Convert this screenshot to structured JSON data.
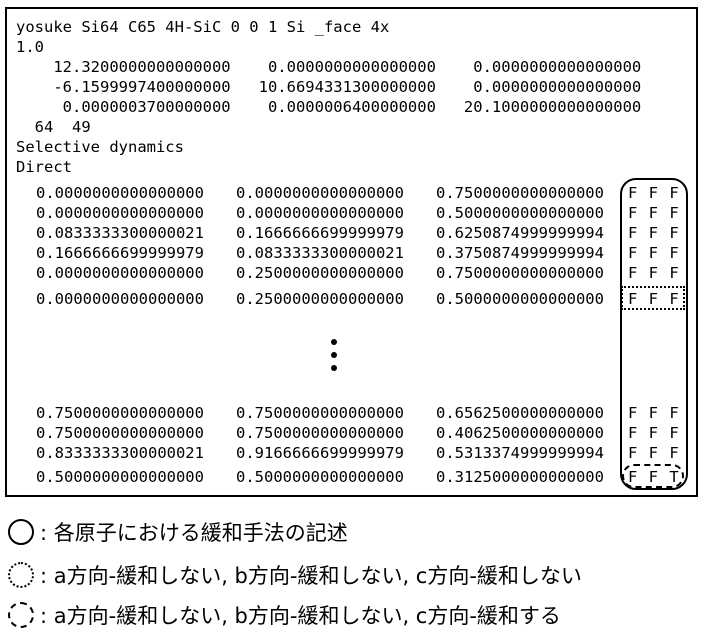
{
  "header": {
    "title_line": "yosuke Si64 C65 4H-SiC 0 0 1 Si _face 4x",
    "scale": "1.0",
    "lattice": [
      "    12.3200000000000000    0.0000000000000000    0.0000000000000000",
      "    -6.1599997400000000   10.6694331300000000    0.0000000000000000",
      "     0.0000003700000000    0.0000006400000000   20.1000000000000000"
    ],
    "counts": "  64  49",
    "selective": "Selective dynamics",
    "coord_type": "Direct"
  },
  "coords_top": [
    {
      "x": "0.0000000000000000",
      "y": "0.0000000000000000",
      "z": "0.7500000000000000",
      "flags": "F F F"
    },
    {
      "x": "0.0000000000000000",
      "y": "0.0000000000000000",
      "z": "0.5000000000000000",
      "flags": "F F F"
    },
    {
      "x": "0.0833333300000021",
      "y": "0.1666666699999979",
      "z": "0.6250874999999994",
      "flags": "F F F"
    },
    {
      "x": "0.1666666699999979",
      "y": "0.0833333300000021",
      "z": "0.3750874999999994",
      "flags": "F F F"
    },
    {
      "x": "0.0000000000000000",
      "y": "0.2500000000000000",
      "z": "0.7500000000000000",
      "flags": "F F F"
    },
    {
      "x": "0.0000000000000000",
      "y": "0.2500000000000000",
      "z": "0.5000000000000000",
      "flags": "F F F"
    }
  ],
  "coords_bottom": [
    {
      "x": "0.7500000000000000",
      "y": "0.7500000000000000",
      "z": "0.6562500000000000",
      "flags": "F F F"
    },
    {
      "x": "0.7500000000000000",
      "y": "0.7500000000000000",
      "z": "0.4062500000000000",
      "flags": "F F F"
    },
    {
      "x": "0.8333333300000021",
      "y": "0.9166666699999979",
      "z": "0.5313374999999994",
      "flags": "F F F"
    },
    {
      "x": "0.5000000000000000",
      "y": "0.5000000000000000",
      "z": "0.3125000000000000",
      "flags": "F F T"
    }
  ],
  "legend": [
    {
      "style": "solid",
      "text": ": 各原子における緩和手法の記述"
    },
    {
      "style": "dotted",
      "text": ": a方向-緩和しない,  b方向-緩和しない,  c方向-緩和しない"
    },
    {
      "style": "dashed",
      "text": ": a方向-緩和しない,  b方向-緩和しない,  c方向-緩和する"
    }
  ]
}
